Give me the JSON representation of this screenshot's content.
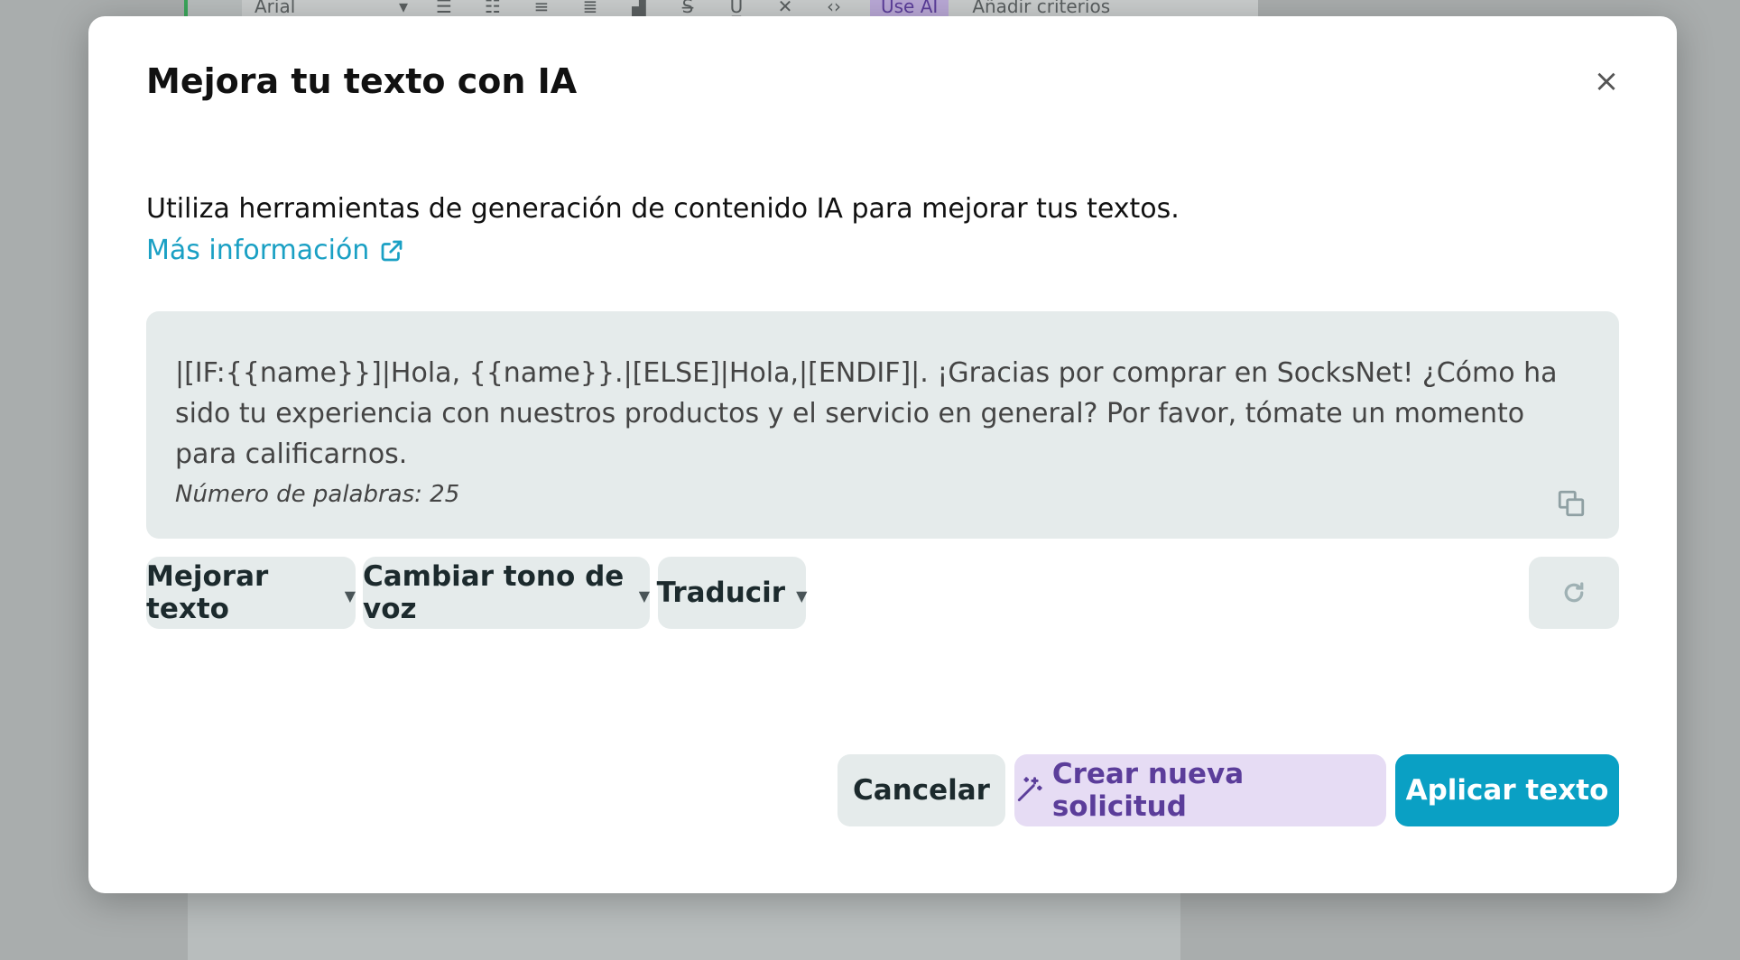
{
  "background": {
    "toolbar": {
      "font_value": "Arial",
      "use_ai_label": "Use AI",
      "criteria_label": "Añadir criterios"
    }
  },
  "modal": {
    "title": "Mejora tu texto con IA",
    "close_glyph": "×",
    "description": "Utiliza herramientas de generación de contenido IA para mejorar tus textos.",
    "more_info_label": "Más información",
    "text_content": "|[IF:{{name}}]|Hola, {{name}}.|[ELSE]|Hola,|[ENDIF]|.  ¡Gracias por comprar en SocksNet!  ¿Cómo ha sido tu experiencia con nuestros productos y el servicio en general? Por favor, tómate un momento para calificarnos.",
    "word_count_label": "Número de palabras: 25",
    "actions": {
      "improve_label": "Mejorar texto",
      "tone_label": "Cambiar tono de voz",
      "translate_label": "Traducir"
    },
    "footer": {
      "cancel_label": "Cancelar",
      "new_request_label": "Crear nueva solicitud",
      "apply_label": "Aplicar texto"
    }
  },
  "colors": {
    "accent": "#0aa0c4",
    "ai_purple": "#5b3d9a",
    "ai_purple_bg": "#e6dcf4",
    "neutral_bg": "#e5ebeb"
  }
}
